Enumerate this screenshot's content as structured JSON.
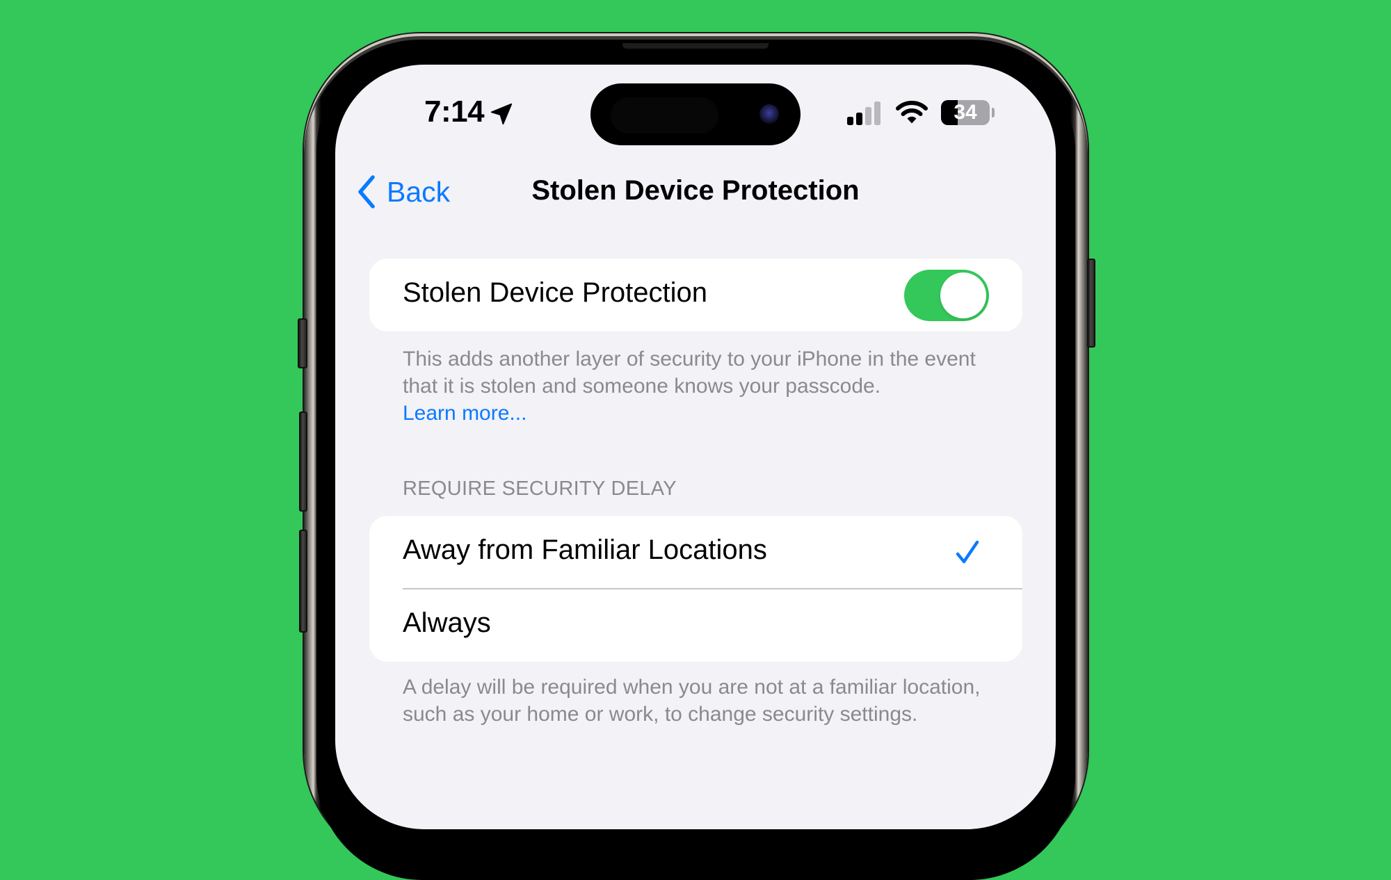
{
  "theme": {
    "background": "#34C759",
    "screen_bg": "#F2F2F7",
    "accent": "#0A7AFF",
    "toggle_on": "#34C759",
    "secondary_text": "#8A8A8E"
  },
  "status_bar": {
    "time": "7:14",
    "location_icon": "location-arrow-icon",
    "signal_bars_total": 4,
    "signal_bars_filled": 2,
    "wifi_icon": "wifi-icon",
    "battery_percent": 34,
    "battery_label": "34"
  },
  "nav": {
    "back_label": "Back",
    "title": "Stolen Device Protection"
  },
  "protection": {
    "label": "Stolen Device Protection",
    "enabled": true,
    "footer_text": "This adds another layer of security to your iPhone in the event that it is stolen and someone knows your passcode.",
    "learn_more": "Learn more..."
  },
  "security_delay": {
    "header": "REQUIRE SECURITY DELAY",
    "options": [
      {
        "label": "Away from Familiar Locations",
        "selected": true
      },
      {
        "label": "Always",
        "selected": false
      }
    ],
    "footer_text": "A delay will be required when you are not at a familiar location, such as your home or work, to change security settings."
  }
}
